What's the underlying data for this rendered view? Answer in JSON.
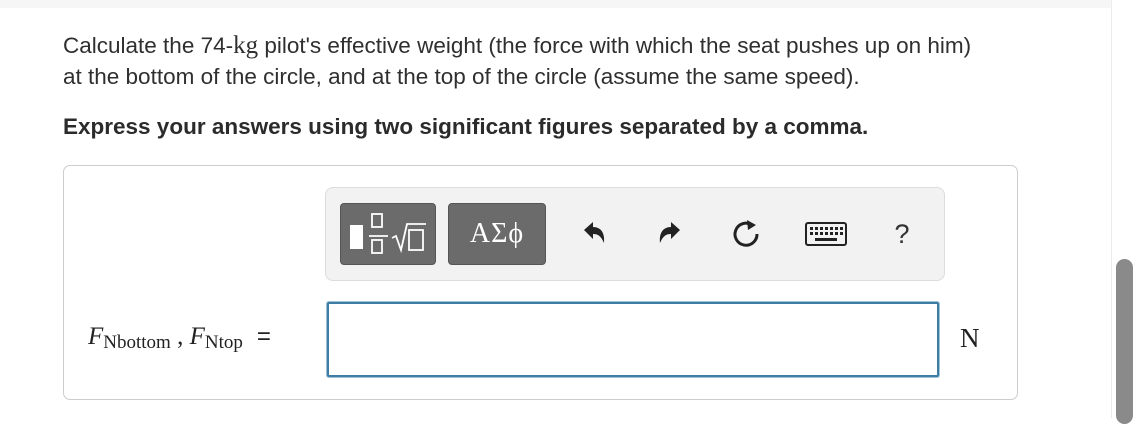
{
  "question": {
    "line1_pre": "Calculate the 74-",
    "line1_unit": "kg",
    "line1_post": " pilot's effective weight (the force with which the seat pushes up on him)",
    "line2": "at the bottom of the circle, and at the top of the circle (assume the same speed)."
  },
  "instruction": "Express your answers using two significant figures separated by a comma.",
  "toolbar": {
    "symbols_label": "ΑΣϕ",
    "help_label": "?",
    "icons": [
      "templates-icon",
      "undo-icon",
      "redo-icon",
      "reset-icon",
      "keyboard-icon",
      "help-icon"
    ]
  },
  "answer": {
    "var1": "F",
    "var1_sub": "Nbottom",
    "separator": " , ",
    "var2": "F",
    "var2_sub": "Ntop",
    "equals": "=",
    "input_value": "",
    "unit": "N"
  },
  "colors": {
    "input_border": "#3e7da3",
    "toolbar_button": "#6b6b6b",
    "text": "#2f2f2f"
  }
}
